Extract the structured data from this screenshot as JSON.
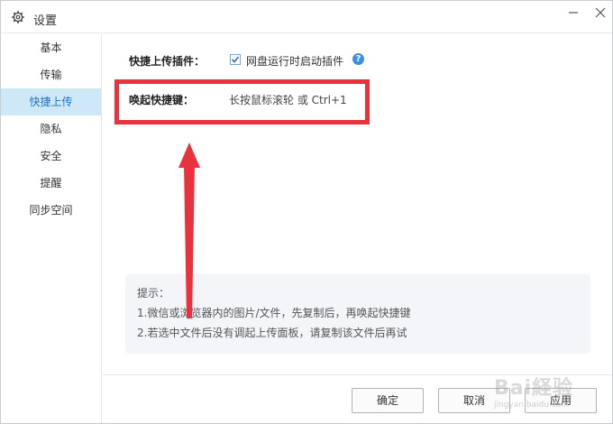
{
  "window": {
    "title": "设置"
  },
  "sidebar": {
    "items": [
      {
        "label": "基本"
      },
      {
        "label": "传输"
      },
      {
        "label": "快捷上传",
        "active": true
      },
      {
        "label": "隐私"
      },
      {
        "label": "安全"
      },
      {
        "label": "提醒"
      },
      {
        "label": "同步空间"
      }
    ]
  },
  "quick_upload": {
    "plugin_label": "快捷上传插件：",
    "plugin_checkbox_label": "网盘运行时启动插件",
    "plugin_checkbox_checked": true,
    "help_icon": "?",
    "hotkey_label": "唤起快捷键：",
    "hotkey_value": "长按鼠标滚轮 或 Ctrl+1"
  },
  "tips": {
    "title": "提示：",
    "lines": [
      "1.微信或浏览器内的图片/文件，先复制后，再唤起快捷键",
      "2.若选中文件后没有调起上传面板，请复制该文件后再试"
    ]
  },
  "footer": {
    "ok_label": "确定",
    "cancel_label": "取消",
    "apply_label": "应用"
  },
  "annotation": {
    "color": "#e8323c"
  },
  "watermark": {
    "text": "Bai経验",
    "sub": "jingyan.baidu.com"
  }
}
